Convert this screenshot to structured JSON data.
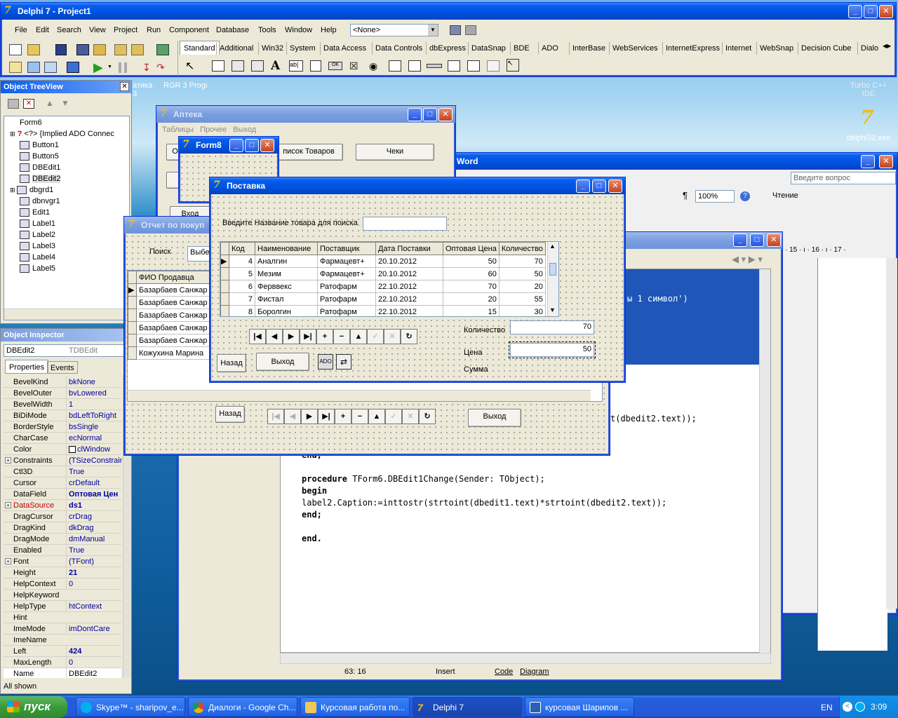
{
  "main": {
    "title": "Delphi 7 - Project1",
    "menu": [
      "File",
      "Edit",
      "Search",
      "View",
      "Project",
      "Run",
      "Component",
      "Database",
      "Tools",
      "Window",
      "Help"
    ],
    "combo_value": "<None>",
    "palette_tabs": [
      "Standard",
      "Additional",
      "Win32",
      "System",
      "Data Access",
      "Data Controls",
      "dbExpress",
      "DataSnap",
      "BDE",
      "ADO",
      "InterBase",
      "WebServices",
      "InternetExpress",
      "Internet",
      "WebSnap",
      "Decision Cube",
      "Dialo"
    ]
  },
  "desktop": {
    "icon_top_label": "Turbo C++\nIDE",
    "icon_label": "delphi32.exe",
    "bg_text1": "атика",
    "bg_text2": "RGR 3 Progi",
    "bg_text3": "3"
  },
  "tree": {
    "title": "Object TreeView",
    "items": [
      "Form6",
      "<?> {Implied ADO Connec",
      "Button1",
      "Button5",
      "DBEdit1",
      "DBEdit2",
      "dbgrd1",
      "dbnvgr1",
      "Edit1",
      "Label1",
      "Label2",
      "Label3",
      "Label4",
      "Label5"
    ]
  },
  "inspector": {
    "title": "Object Inspector",
    "selected_name": "DBEdit2",
    "selected_type": "TDBEdit",
    "tab_properties": "Properties",
    "tab_events": "Events",
    "status": "All shown",
    "rows": [
      {
        "n": "BevelKind",
        "v": "bkNone"
      },
      {
        "n": "BevelOuter",
        "v": "bvLowered"
      },
      {
        "n": "BevelWidth",
        "v": "1"
      },
      {
        "n": "BiDiMode",
        "v": "bdLeftToRight"
      },
      {
        "n": "BorderStyle",
        "v": "bsSingle"
      },
      {
        "n": "CharCase",
        "v": "ecNormal"
      },
      {
        "n": "Color",
        "v": "clWindow"
      },
      {
        "n": "Constraints",
        "v": "(TSizeConstrain"
      },
      {
        "n": "Ctl3D",
        "v": "True"
      },
      {
        "n": "Cursor",
        "v": "crDefault"
      },
      {
        "n": "DataField",
        "v": "Оптовая Цен"
      },
      {
        "n": "DataSource",
        "v": "ds1"
      },
      {
        "n": "DragCursor",
        "v": "crDrag"
      },
      {
        "n": "DragKind",
        "v": "dkDrag"
      },
      {
        "n": "DragMode",
        "v": "dmManual"
      },
      {
        "n": "Enabled",
        "v": "True"
      },
      {
        "n": "Font",
        "v": "(TFont)"
      },
      {
        "n": "Height",
        "v": "21"
      },
      {
        "n": "HelpContext",
        "v": "0"
      },
      {
        "n": "HelpKeyword",
        "v": ""
      },
      {
        "n": "HelpType",
        "v": "htContext"
      },
      {
        "n": "Hint",
        "v": ""
      },
      {
        "n": "ImeMode",
        "v": "imDontCare"
      },
      {
        "n": "ImeName",
        "v": ""
      },
      {
        "n": "Left",
        "v": "424"
      },
      {
        "n": "MaxLength",
        "v": "0"
      },
      {
        "n": "Name",
        "v": "DBEdit2"
      }
    ]
  },
  "apteka": {
    "title": "Аптека",
    "menu": [
      "Таблицы",
      "Прочее",
      "Выход"
    ],
    "btn_goods": "писок Товаров",
    "btn_checks": "Чеки",
    "btn_left_partial": "От",
    "btn_exit_partial": "Вход"
  },
  "form8": {
    "title": "Form8"
  },
  "report": {
    "title": "Отчет по покуп",
    "search_label": "Поиск",
    "search_value": "Выбе",
    "col_fio": "ФИО Продавца",
    "rows": [
      "Базарбаев Санжар",
      "Базарбаев Санжар",
      "Базарбаев Санжар",
      "Базарбаев Санжар",
      "Базарбаев Санжар",
      "Кожухина Марина"
    ],
    "btn_back": "Назад",
    "btn_exit": "Выход"
  },
  "postavka": {
    "title": "Поставка",
    "search_label": "Введите Название товара для поиска",
    "search_value": "",
    "columns": [
      "Код",
      "Наименование",
      "Поставщик",
      "Дата Поставки",
      "Оптовая Цена",
      "Количество"
    ],
    "rows": [
      [
        "4",
        "Аналгин",
        "Фармацевт+",
        "20.10.2012",
        "50",
        "70"
      ],
      [
        "5",
        "Мезим",
        "Фармацевт+",
        "20.10.2012",
        "60",
        "50"
      ],
      [
        "6",
        "Ферввекс",
        "Ратофарм",
        "22.10.2012",
        "70",
        "20"
      ],
      [
        "7",
        "Фистал",
        "Ратофарм",
        "22.10.2012",
        "20",
        "55"
      ],
      [
        "8",
        "Боролгин",
        "Ратофарм",
        "22.10.2012",
        "15",
        "30"
      ]
    ],
    "qty_label": "Количество",
    "qty_value": "70",
    "price_label": "Цена",
    "price_value": "50",
    "sum_label": "Сумма",
    "btn_back": "Назад",
    "btn_exit": "Выход"
  },
  "word": {
    "title_partial": "Word",
    "ask": "Введите вопрос",
    "zoom": "100%",
    "read": "Чтение",
    "ruler": "· 15 · ı · 16 · ı · 17 ·"
  },
  "editor": {
    "code_partial1": "ы 1 символ')",
    "code_partial2": "t(dbedit2.text));",
    "code_partial3": "end;",
    "line1_kw": "procedure",
    "line1_rest": " TForm6.DBEdit1Change(Sender: TObject);",
    "line2": "begin",
    "line3": "label2.Caption:=inttostr(strtoint(dbedit1.text)*strtoint(dbedit2.text));",
    "line4": "end;",
    "line5": "end.",
    "status_pos": "63: 16",
    "status_mode": "Insert",
    "tab_code": "Code",
    "tab_diagram": "Diagram"
  },
  "taskbar": {
    "start": "пуск",
    "items": [
      "Skype™ - sharipov_e...",
      "Диалоги - Google Ch...",
      "Курсовая работа по...",
      "Delphi 7",
      "курсовая Шарипов ..."
    ],
    "lang": "EN",
    "time": "3:09"
  }
}
